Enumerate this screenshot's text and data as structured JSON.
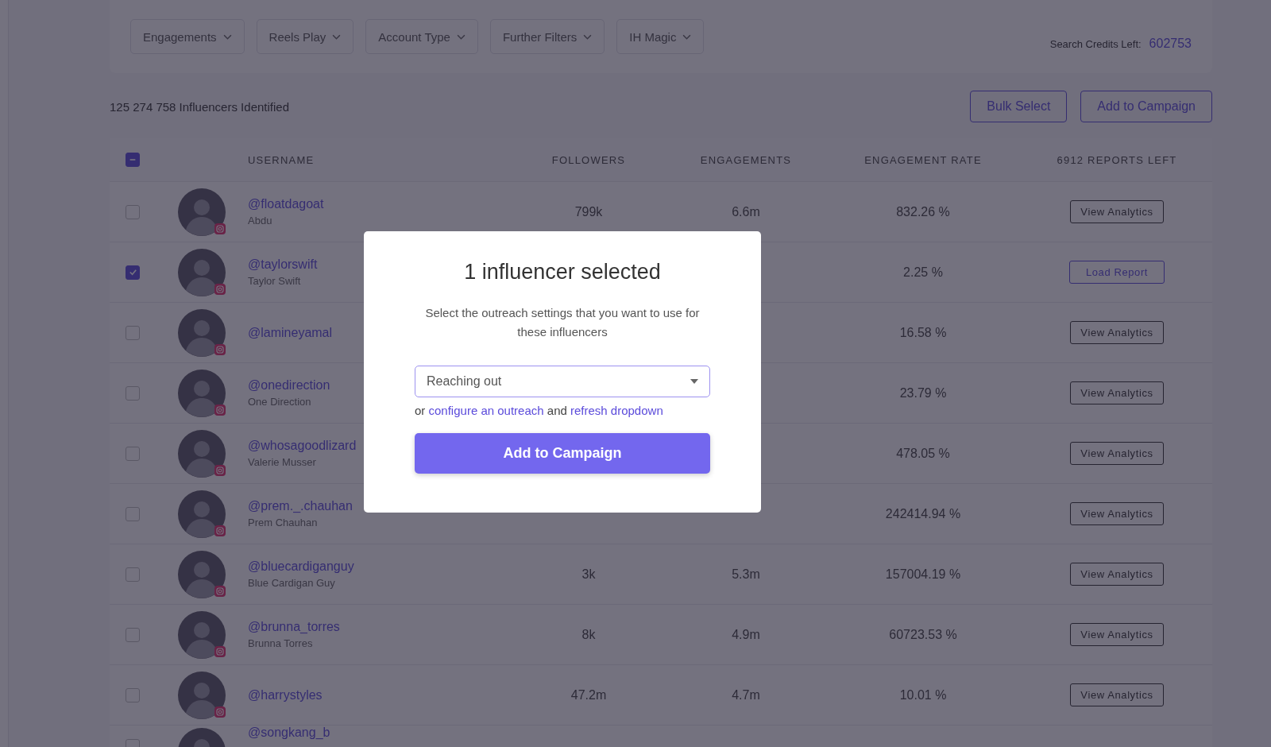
{
  "filters": [
    {
      "label": "Engagements"
    },
    {
      "label": "Reels Play"
    },
    {
      "label": "Account Type"
    },
    {
      "label": "Further Filters"
    },
    {
      "label": "IH Magic"
    }
  ],
  "credits": {
    "label": "Search Credits Left:",
    "value": "602753"
  },
  "results_count": "125 274 758 Influencers Identified",
  "actions": [
    {
      "label": "Bulk Select"
    },
    {
      "label": "Add to Campaign"
    }
  ],
  "table": {
    "select_all": {
      "checked": true,
      "indeterminate": true
    },
    "columns": [
      "USERNAME",
      "FOLLOWERS",
      "ENGAGEMENTS",
      "ENGAGEMENT RATE",
      "6912 REPORTS LEFT"
    ],
    "rows": [
      {
        "selected": false,
        "username": "@floatdagoat",
        "name": "Abdu",
        "followers": "799k",
        "engagements": "6.6m",
        "rate": "832.26 %",
        "action": {
          "kind": "view",
          "label": "View Analytics"
        }
      },
      {
        "selected": true,
        "username": "@taylorswift",
        "name": "Taylor Swift",
        "rate": "2.25 %",
        "action": {
          "kind": "load",
          "label": "Load Report"
        }
      },
      {
        "selected": false,
        "username": "@lamineyamal",
        "rate": "16.58 %",
        "action": {
          "kind": "view",
          "label": "View Analytics"
        }
      },
      {
        "selected": false,
        "username": "@onedirection",
        "name": "One Direction",
        "rate": "23.79 %",
        "action": {
          "kind": "view",
          "label": "View Analytics"
        }
      },
      {
        "selected": false,
        "username": "@whosagoodlizard",
        "name": "Valerie Musser",
        "rate": "478.05 %",
        "action": {
          "kind": "view",
          "label": "View Analytics"
        }
      },
      {
        "selected": false,
        "username": "@prem._.chauhan",
        "name": "Prem Chauhan",
        "rate": "242414.94 %",
        "action": {
          "kind": "view",
          "label": "View Analytics"
        }
      },
      {
        "selected": false,
        "username": "@bluecardiganguy",
        "name": "Blue Cardigan Guy",
        "followers": "3k",
        "engagements": "5.3m",
        "rate": "157004.19 %",
        "action": {
          "kind": "view",
          "label": "View Analytics"
        }
      },
      {
        "selected": false,
        "username": "@brunna_torres",
        "name": "Brunna Torres",
        "followers": "8k",
        "engagements": "4.9m",
        "rate": "60723.53 %",
        "action": {
          "kind": "view",
          "label": "View Analytics"
        }
      },
      {
        "selected": false,
        "username": "@harrystyles",
        "followers": "47.2m",
        "engagements": "4.7m",
        "rate": "10.01 %",
        "action": {
          "kind": "view",
          "label": "View Analytics"
        }
      },
      {
        "selected": false,
        "username": "@songkang_b"
      }
    ]
  },
  "modal": {
    "title": "1 influencer selected",
    "description": "Select the outreach settings that you want to use for these influencers",
    "select": {
      "value": "Reaching out"
    },
    "helper": [
      {
        "kind": "text",
        "text": "or"
      },
      {
        "kind": "link",
        "text": "configure an outreach"
      },
      {
        "kind": "text",
        "text": "and"
      },
      {
        "kind": "link",
        "text": "refresh dropdown"
      }
    ],
    "button": "Add to Campaign"
  }
}
